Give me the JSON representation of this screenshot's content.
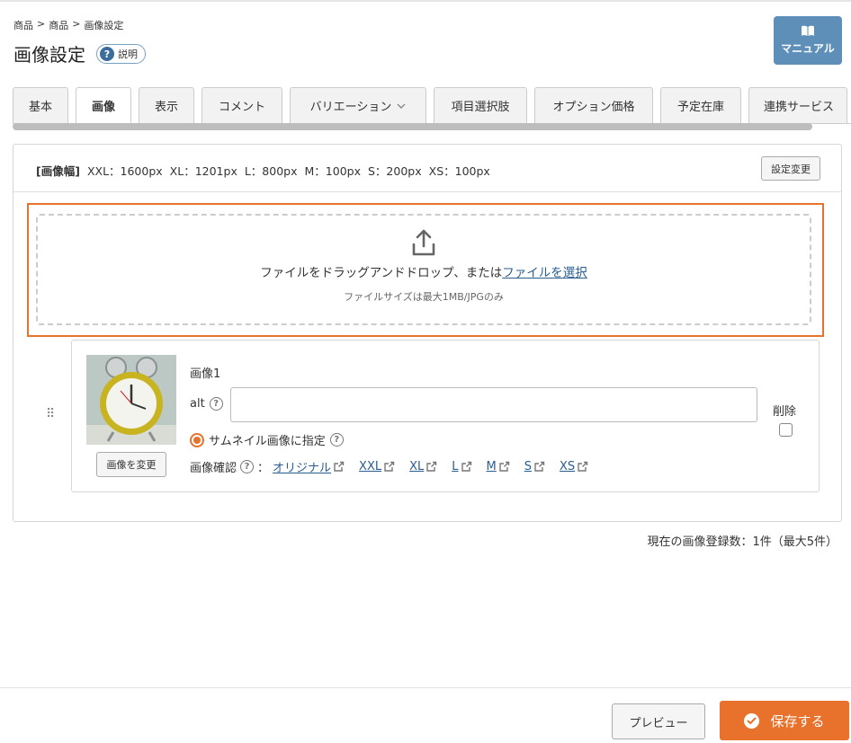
{
  "breadcrumb": [
    "商品",
    ">",
    "商品",
    ">",
    "画像設定"
  ],
  "page_title": "画像設定",
  "help_label": "説明",
  "manual_label": "マニュアル",
  "tabs": [
    {
      "label": "基本",
      "active": false
    },
    {
      "label": "画像",
      "active": true
    },
    {
      "label": "表示",
      "active": false
    },
    {
      "label": "コメント",
      "active": false
    },
    {
      "label": "バリエーション",
      "active": false
    },
    {
      "label": "項目選択肢",
      "active": false
    },
    {
      "label": "オプション価格",
      "active": false
    },
    {
      "label": "予定在庫",
      "active": false
    },
    {
      "label": "連携サービス",
      "active": false
    }
  ],
  "image_width": {
    "label": "[画像幅]",
    "sizes": [
      "XXL：1600px",
      "XL：1201px",
      "L：800px",
      "M：100px",
      "S：200px",
      "XS：100px"
    ],
    "settings_button": "設定変更"
  },
  "dropzone": {
    "text": "ファイルをドラッグアンドドロップ、または",
    "link": "ファイルを選択",
    "note": "ファイルサイズは最大1MB/JPGのみ"
  },
  "image_item": {
    "title": "画像1",
    "alt_label": "alt",
    "alt_value": "",
    "thumbnail_label": "サムネイル画像に指定",
    "change_button": "画像を変更",
    "confirm_label": "画像確認",
    "confirm_colon": "：",
    "links": [
      "オリジナル",
      "XXL",
      "XL",
      "L",
      "M",
      "S",
      "XS"
    ],
    "delete_label": "削除"
  },
  "count_text": "現在の画像登録数：1件（最大5件）",
  "footer": {
    "preview_label": "プレビュー",
    "save_label": "保存する"
  },
  "colors": {
    "accent": "#e8722c",
    "manual": "#5d8fb8",
    "link": "#2a5d8f"
  }
}
